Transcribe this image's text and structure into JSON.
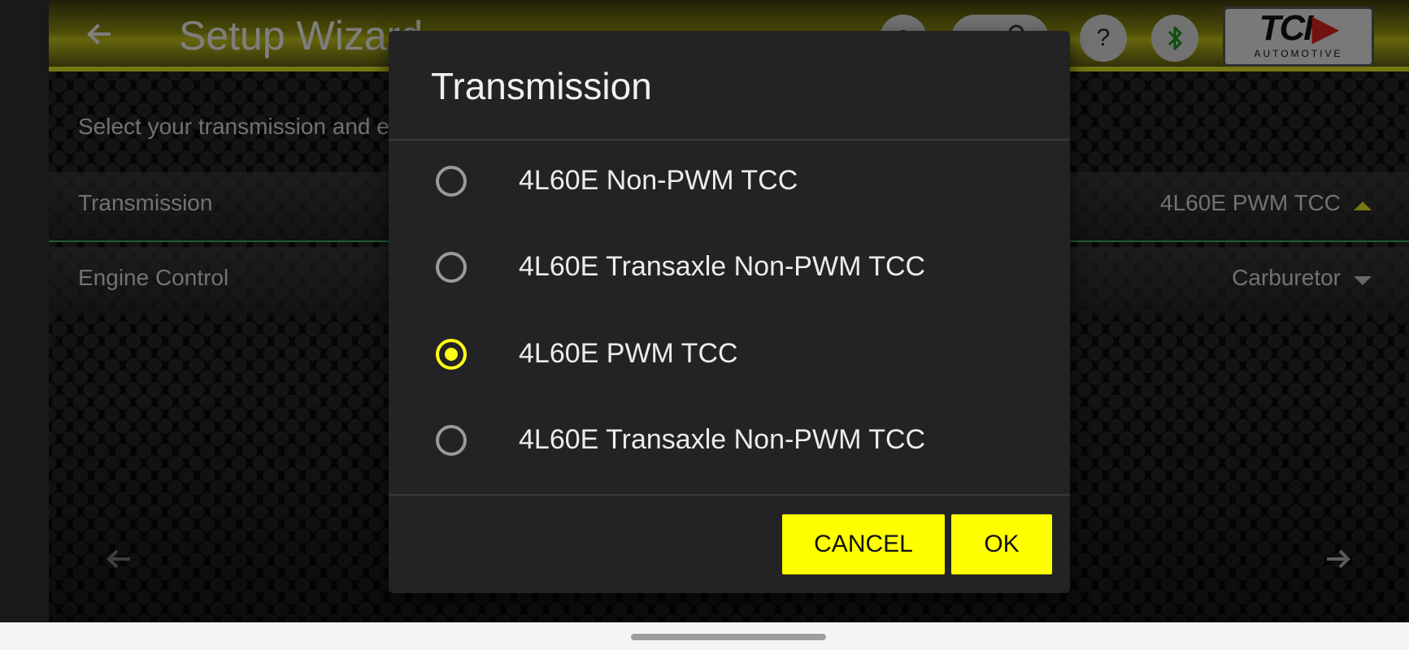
{
  "app": {
    "title": "Setup Wizard",
    "instructions": "Select your transmission and engine control",
    "logo": {
      "brand": "TCI",
      "sub": "AUTOMOTIVE"
    },
    "header_icons": [
      "back-arrow-icon",
      "settings-icon",
      "user-icon",
      "help-icon",
      "bluetooth-icon"
    ],
    "help_glyph": "?",
    "rows": [
      {
        "label": "Transmission",
        "value": "4L60E PWM TCC"
      },
      {
        "label": "Engine Control",
        "value": "Carburetor"
      }
    ]
  },
  "dialog": {
    "title": "Transmission",
    "options": [
      {
        "label": "4L60E Non-PWM TCC",
        "selected": false
      },
      {
        "label": "4L60E Transaxle Non-PWM TCC",
        "selected": false
      },
      {
        "label": "4L60E PWM TCC",
        "selected": true
      },
      {
        "label": "4L60E Transaxle Non-PWM TCC",
        "selected": false
      }
    ],
    "cancel_label": "CANCEL",
    "ok_label": "OK"
  },
  "colors": {
    "accent": "#ffff00",
    "divider": "#3fa66a",
    "dialog_bg": "#232325"
  }
}
